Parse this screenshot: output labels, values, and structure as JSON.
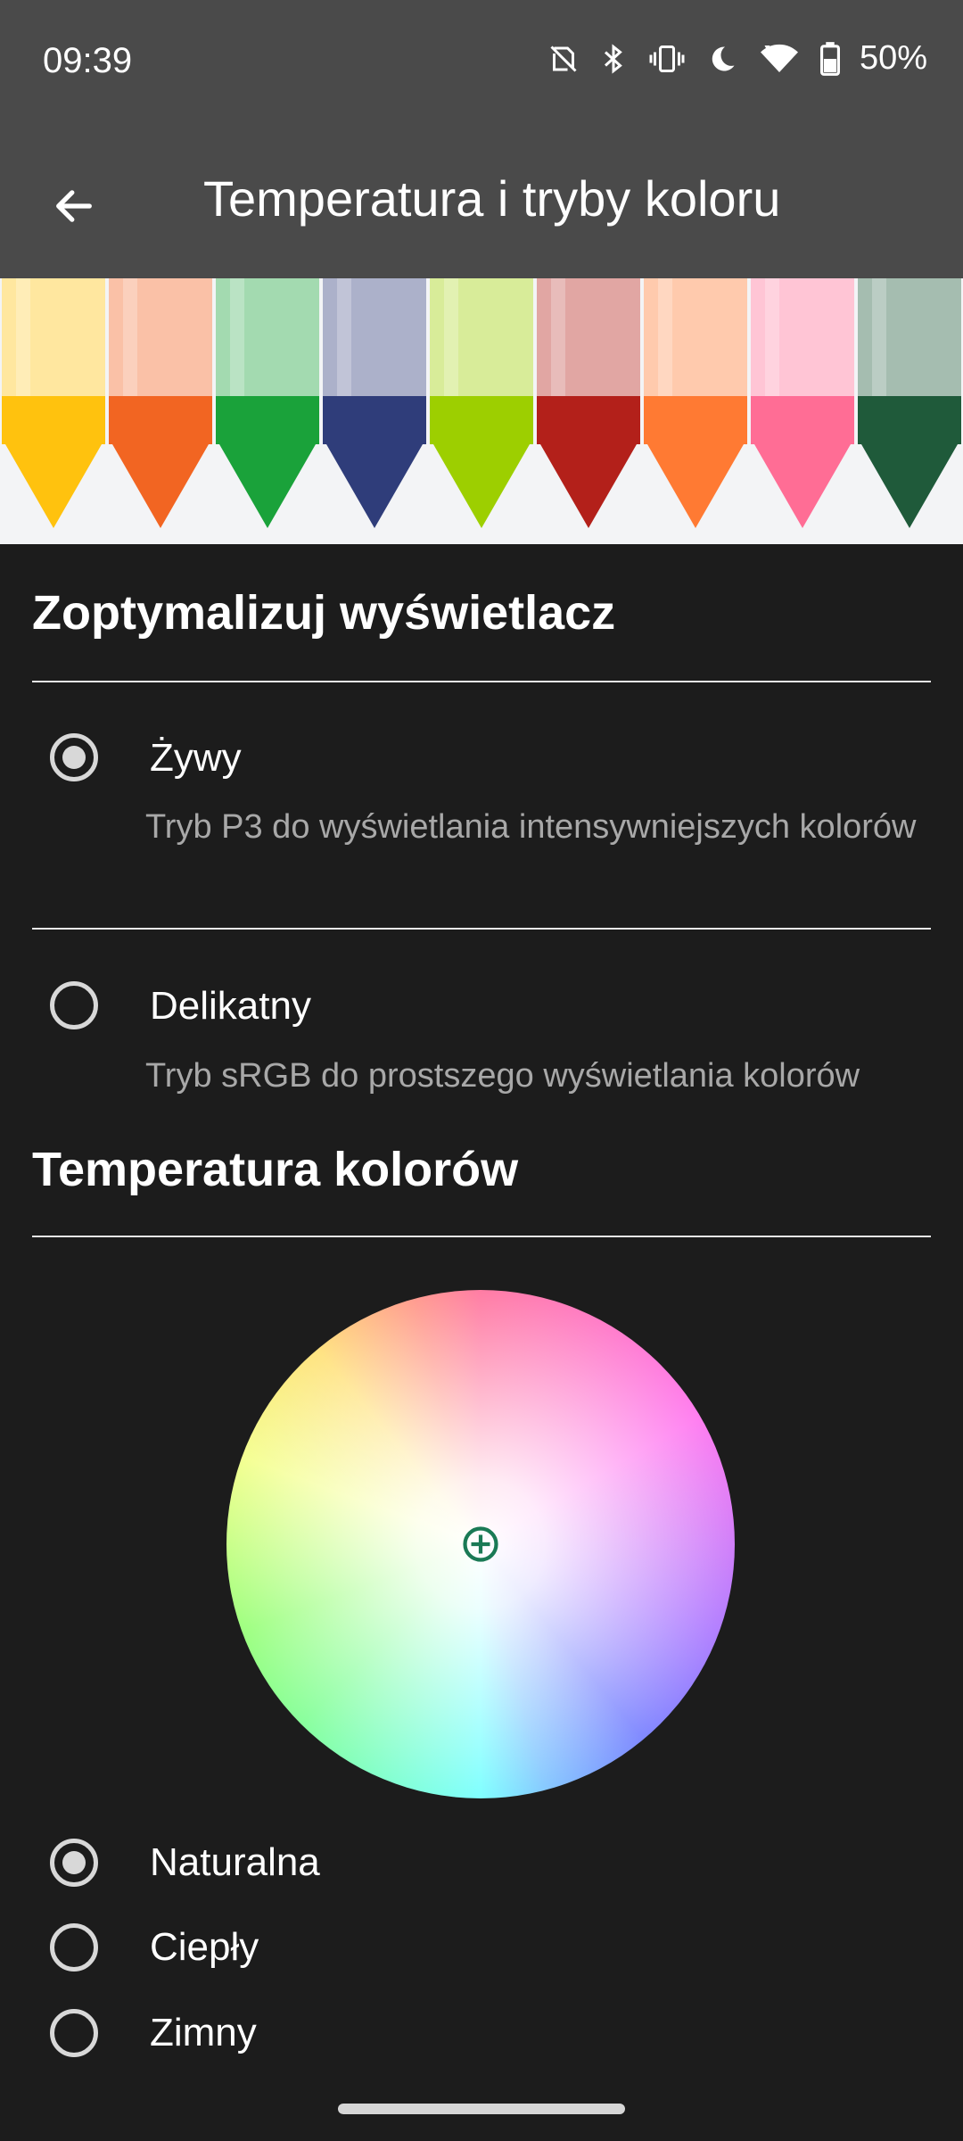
{
  "status_bar": {
    "time": "09:39",
    "battery": "50%",
    "icons": [
      "nfc-off-icon",
      "bluetooth-icon",
      "vibrate-icon",
      "do-not-disturb-moon-icon",
      "wifi-icon",
      "battery-icon"
    ]
  },
  "app_bar": {
    "title": "Temperatura i tryby koloru",
    "back_icon": "back-arrow-icon"
  },
  "banner": {
    "crayon_colors": [
      "#ffc20e",
      "#f26522",
      "#1aa23a",
      "#2f3d7a",
      "#9dcf00",
      "#b3201a",
      "#ff7a33",
      "#ff6d95",
      "#1f5a3a"
    ]
  },
  "display_section": {
    "title": "Zoptymalizuj wyświetlacz",
    "options": [
      {
        "label": "Żywy",
        "description": "Tryb P3 do wyświetlania intensywniejszych kolorów",
        "selected": true
      },
      {
        "label": "Delikatny",
        "description": "Tryb sRGB do prostszego wyświetlania kolorów",
        "selected": false
      }
    ]
  },
  "temperature_section": {
    "title": "Temperatura kolorów",
    "options": [
      {
        "label": "Naturalna",
        "selected": true
      },
      {
        "label": "Ciepły",
        "selected": false
      },
      {
        "label": "Zimny",
        "selected": false
      }
    ]
  },
  "accent_colors": {
    "wheel_marker": "#1a7a55"
  }
}
